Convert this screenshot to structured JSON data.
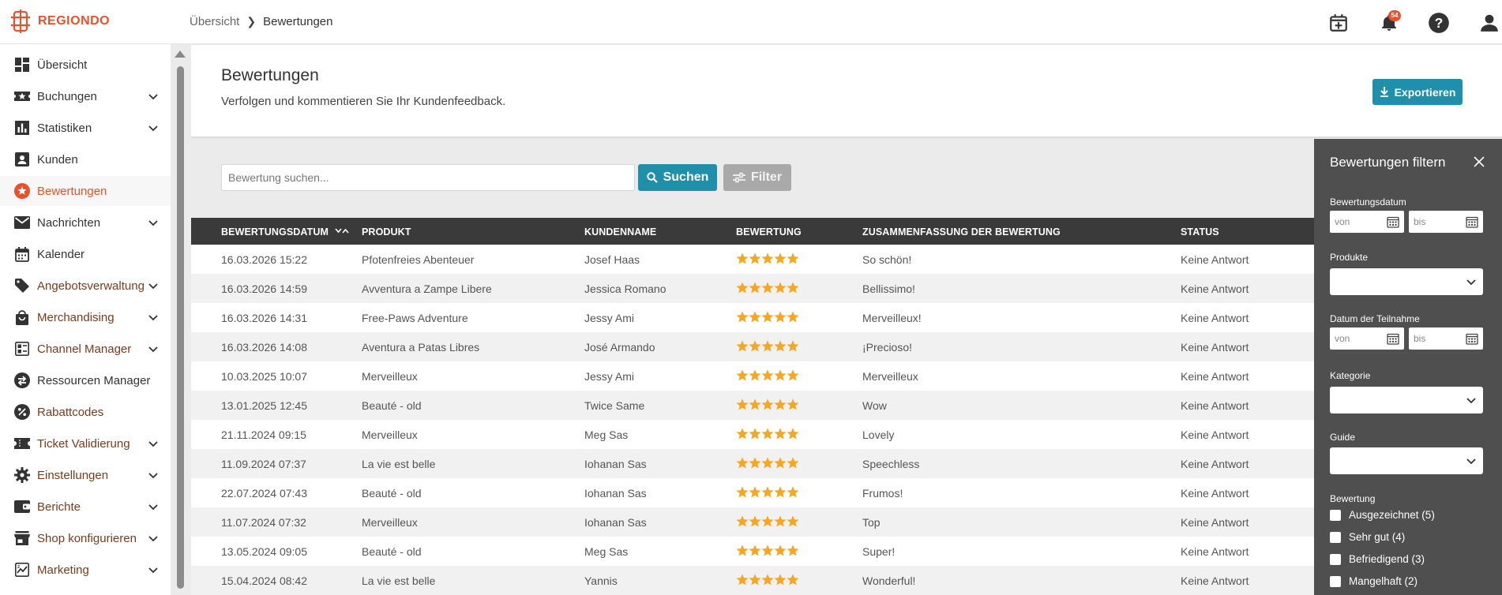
{
  "brand": {
    "name": "REGIONDO",
    "color": "#e8512a"
  },
  "breadcrumb": {
    "items": [
      "Übersicht",
      "Bewertungen"
    ]
  },
  "topbar": {
    "notification_count": "54",
    "icons": [
      "calendar-plus-icon",
      "bell-icon",
      "help-icon",
      "user-icon"
    ]
  },
  "sidebar": {
    "items": [
      {
        "label": "Übersicht",
        "icon": "dashboard-icon",
        "expandable": false
      },
      {
        "label": "Buchungen",
        "icon": "ticket-star-icon",
        "expandable": true
      },
      {
        "label": "Statistiken",
        "icon": "bar-chart-icon",
        "expandable": true
      },
      {
        "label": "Kunden",
        "icon": "contact-icon",
        "expandable": false
      },
      {
        "label": "Bewertungen",
        "icon": "star-circle-icon",
        "expandable": false,
        "active": true
      },
      {
        "label": "Nachrichten",
        "icon": "mail-icon",
        "expandable": true
      },
      {
        "label": "Kalender",
        "icon": "calendar-icon",
        "expandable": false
      },
      {
        "label": "Angebotsverwaltung",
        "icon": "tag-icon",
        "expandable": true
      },
      {
        "label": "Merchandising",
        "icon": "shopping-bag-icon",
        "expandable": true
      },
      {
        "label": "Channel Manager",
        "icon": "channel-grid-icon",
        "expandable": true
      },
      {
        "label": "Ressourcen Manager",
        "icon": "swap-circle-icon",
        "expandable": false
      },
      {
        "label": "Rabattcodes",
        "icon": "percent-icon",
        "expandable": false
      },
      {
        "label": "Ticket Validierung",
        "icon": "ticket-icon",
        "expandable": true
      },
      {
        "label": "Einstellungen",
        "icon": "gear-icon",
        "expandable": true
      },
      {
        "label": "Berichte",
        "icon": "report-icon",
        "expandable": true
      },
      {
        "label": "Shop konfigurieren",
        "icon": "store-icon",
        "expandable": true
      },
      {
        "label": "Marketing",
        "icon": "marketing-icon",
        "expandable": true
      }
    ]
  },
  "header": {
    "title": "Bewertungen",
    "subtitle": "Verfolgen und kommentieren Sie Ihr Kundenfeedback.",
    "export_label": "Exportieren"
  },
  "search": {
    "placeholder": "Bewertung suchen...",
    "search_label": "Suchen",
    "filter_label": "Filter"
  },
  "table": {
    "columns": [
      "BEWERTUNGSDATUM",
      "PRODUKT",
      "KUNDENNAME",
      "BEWERTUNG",
      "ZUSAMMENFASSUNG DER BEWERTUNG",
      "STATUS"
    ],
    "sort_column": "BEWERTUNGSDATUM",
    "star_color": "#f5a623",
    "rows": [
      {
        "date": "16.03.2026 15:22",
        "product": "Pfotenfreies Abenteuer",
        "customer": "Josef Haas",
        "rating": 5,
        "summary": "So schön!",
        "status": "Keine Antwort"
      },
      {
        "date": "16.03.2026 14:59",
        "product": "Avventura a Zampe Libere",
        "customer": "Jessica Romano",
        "rating": 5,
        "summary": "Bellissimo!",
        "status": "Keine Antwort"
      },
      {
        "date": "16.03.2026 14:31",
        "product": "Free-Paws Adventure",
        "customer": "Jessy Ami",
        "rating": 5,
        "summary": "Merveilleux!",
        "status": "Keine Antwort"
      },
      {
        "date": "16.03.2026 14:08",
        "product": "Aventura a Patas Libres",
        "customer": "José Armando",
        "rating": 5,
        "summary": "¡Precioso!",
        "status": "Keine Antwort"
      },
      {
        "date": "10.03.2025 10:07",
        "product": "Merveilleux",
        "customer": "Jessy Ami",
        "rating": 5,
        "summary": "Merveilleux",
        "status": "Keine Antwort"
      },
      {
        "date": "13.01.2025 12:45",
        "product": "Beauté - old",
        "customer": "Twice Same",
        "rating": 5,
        "summary": "Wow",
        "status": "Keine Antwort"
      },
      {
        "date": "21.11.2024 09:15",
        "product": "Merveilleux",
        "customer": "Meg Sas",
        "rating": 5,
        "summary": "Lovely",
        "status": "Keine Antwort"
      },
      {
        "date": "11.09.2024 07:37",
        "product": "La vie est belle",
        "customer": "Iohanan Sas",
        "rating": 5,
        "summary": "Speechless",
        "status": "Keine Antwort"
      },
      {
        "date": "22.07.2024 07:43",
        "product": "Beauté - old",
        "customer": "Iohanan Sas",
        "rating": 5,
        "summary": "Frumos!",
        "status": "Keine Antwort"
      },
      {
        "date": "11.07.2024 07:32",
        "product": "Merveilleux",
        "customer": "Iohanan Sas",
        "rating": 5,
        "summary": "Top",
        "status": "Keine Antwort"
      },
      {
        "date": "13.05.2024 09:05",
        "product": "Beauté - old",
        "customer": "Meg Sas",
        "rating": 5,
        "summary": "Super!",
        "status": "Keine Antwort"
      },
      {
        "date": "15.04.2024 08:42",
        "product": "La vie est belle",
        "customer": "Yannis",
        "rating": 5,
        "summary": "Wonderful!",
        "status": "Keine Antwort"
      }
    ]
  },
  "filter_panel": {
    "title": "Bewertungen filtern",
    "review_date_label": "Bewertungsdatum",
    "products_label": "Produkte",
    "participation_date_label": "Datum der Teilnahme",
    "category_label": "Kategorie",
    "guide_label": "Guide",
    "rating_label": "Bewertung",
    "from_placeholder": "von",
    "to_placeholder": "bis",
    "rating_options": [
      "Ausgezeichnet (5)",
      "Sehr gut (4)",
      "Befriedigend (3)",
      "Mangelhaft (2)"
    ]
  }
}
